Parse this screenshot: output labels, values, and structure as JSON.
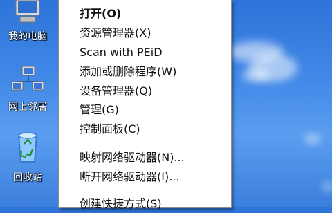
{
  "desktop": {
    "icons": [
      {
        "label": "我的电脑"
      },
      {
        "label": "网上邻居"
      },
      {
        "label": "回收站"
      }
    ]
  },
  "menu": {
    "items": [
      {
        "label": "打开(O)"
      },
      {
        "label": "资源管理器(X)"
      },
      {
        "label": "Scan with PEiD"
      },
      {
        "label": "添加或删除程序(W)"
      },
      {
        "label": "设备管理器(Q)"
      },
      {
        "label": "管理(G)"
      },
      {
        "label": "控制面板(C)"
      },
      {
        "label": "映射网络驱动器(N)..."
      },
      {
        "label": "断开网络驱动器(I)..."
      },
      {
        "label": "创建快捷方式(S)"
      }
    ]
  }
}
